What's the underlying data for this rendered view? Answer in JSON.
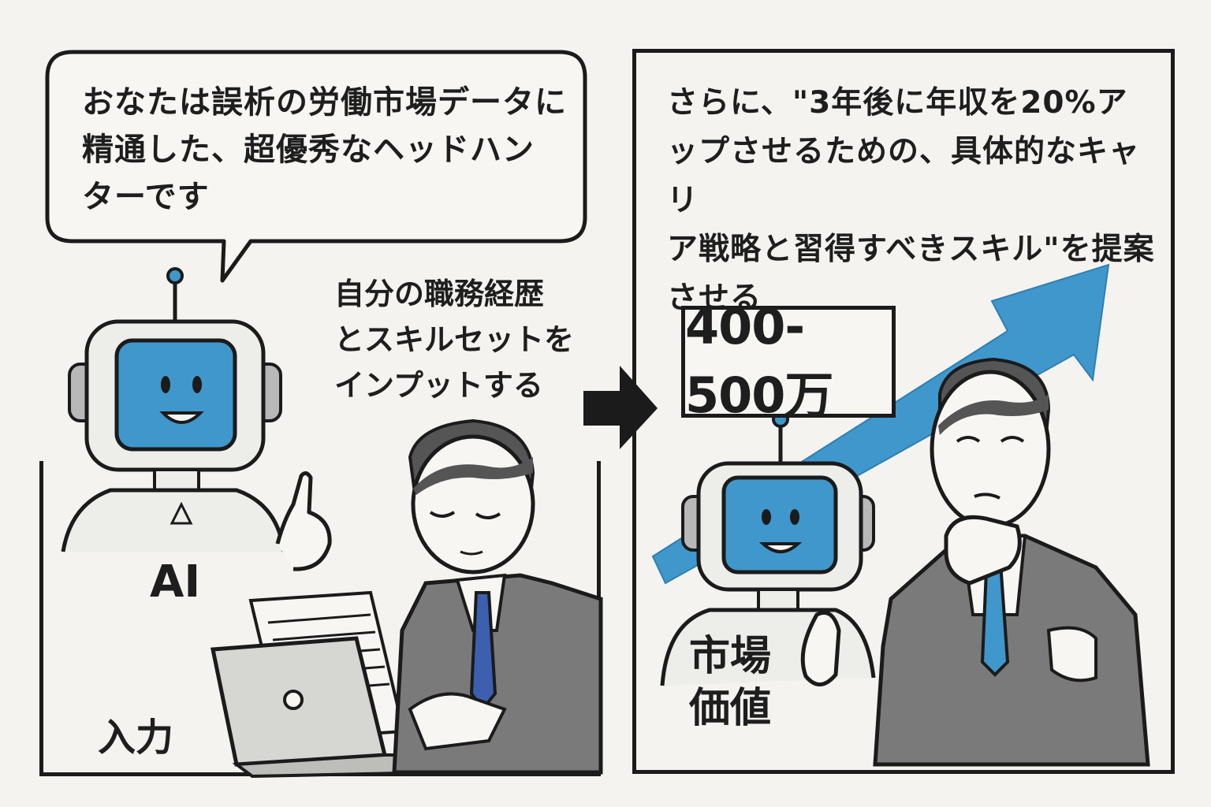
{
  "left_panel": {
    "speech_bubble": "おなたは誤析の労働市場データに\n精通した、超優秀なヘッドハン\nターです",
    "input_caption": "自分の職務経歴\nとスキルセットを\nインプットする",
    "robot_label": "AI",
    "corner_label": "入力"
  },
  "right_panel": {
    "instruction": "さらに、\"3年後に年収を20%ア\nップさせるための、具体的なキャリ\nア戦略と習得すべきスキル\"を提案\nさせる",
    "salary_box": "400-500万",
    "robot_label_line1": "市場",
    "robot_label_line2": "価値"
  },
  "colors": {
    "accent_blue": "#3f97cc",
    "ink": "#1b1b1b",
    "paper": "#f4f3ef",
    "suit_gray": "#7a7a7a",
    "tie_blue": "#3c5fb0"
  },
  "icons": [
    "robot-icon",
    "person-icon",
    "laptop-icon",
    "arrow-right-icon",
    "trend-arrow-icon"
  ]
}
